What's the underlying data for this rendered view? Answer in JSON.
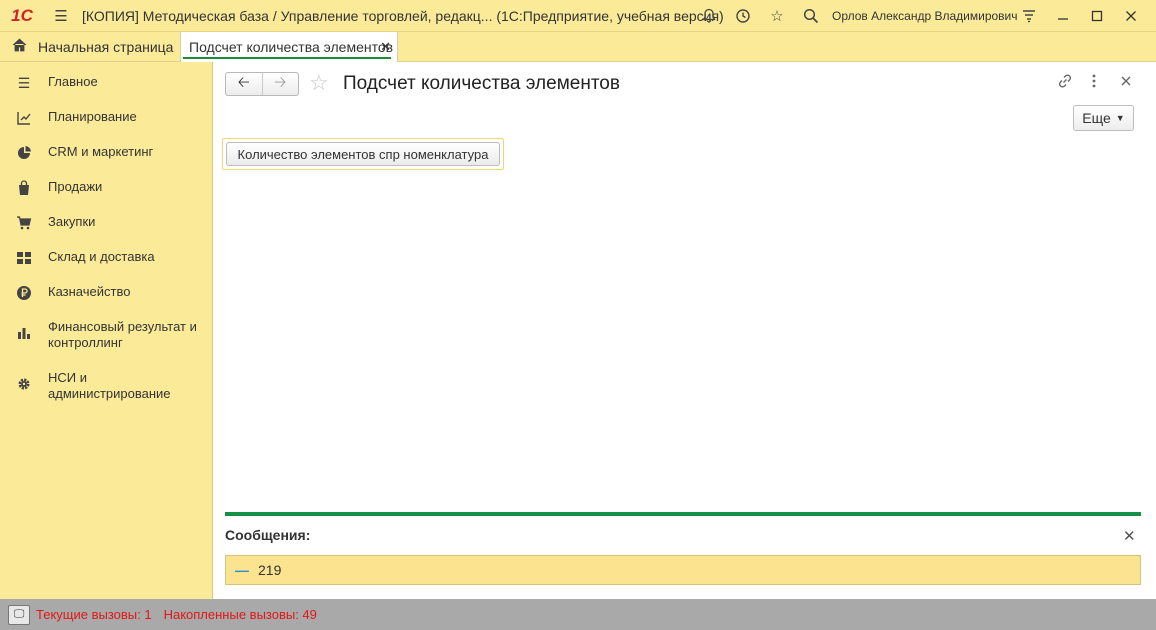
{
  "titlebar": {
    "logo": "1С",
    "title": "[КОПИЯ] Методическая база / Управление торговлей, редакц...   (1С:Предприятие, учебная версия)",
    "user": "Орлов Александр Владимирович"
  },
  "tabs": {
    "home_label": "Начальная страница",
    "active_label": "Подсчет количества элементов"
  },
  "sidebar": {
    "items": [
      {
        "label": "Главное",
        "icon": "menu-icon"
      },
      {
        "label": "Планирование",
        "icon": "planning-icon"
      },
      {
        "label": "CRM и маркетинг",
        "icon": "pie-chart-icon"
      },
      {
        "label": "Продажи",
        "icon": "bag-icon"
      },
      {
        "label": "Закупки",
        "icon": "cart-icon"
      },
      {
        "label": "Склад и доставка",
        "icon": "warehouse-icon"
      },
      {
        "label": "Казначейство",
        "icon": "ruble-icon"
      },
      {
        "label": "Финансовый результат и контроллинг",
        "icon": "bar-chart-icon"
      },
      {
        "label": "НСИ и администрирование",
        "icon": "gear-icon"
      }
    ]
  },
  "form": {
    "title": "Подсчет количества элементов",
    "more_label": "Еще",
    "count_button_label": "Количество элементов спр номенклатура"
  },
  "messages": {
    "title": "Сообщения:",
    "items": [
      "219"
    ]
  },
  "statusbar": {
    "current_calls": "Текущие вызовы: 1",
    "accumulated_calls": "Накопленные вызовы: 49"
  },
  "colors": {
    "panel_yellow": "#fbeb99",
    "accent_green": "#159145",
    "status_red": "#e01818"
  }
}
